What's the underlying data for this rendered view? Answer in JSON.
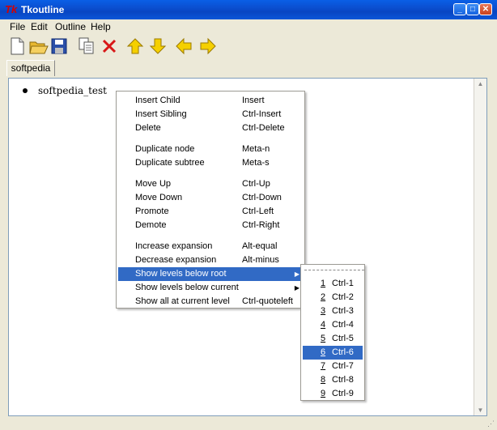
{
  "window": {
    "title": "Tkoutline",
    "app_icon": "Tk"
  },
  "menubar": [
    "File",
    "Edit",
    "Outline",
    "Help"
  ],
  "toolbar": [
    "new-file-icon",
    "open-folder-icon",
    "save-icon",
    "copy-icon",
    "delete-x-icon",
    "arrow-up-icon",
    "arrow-down-icon",
    "arrow-left-icon",
    "arrow-right-icon"
  ],
  "tabs": [
    {
      "label": "softpedia"
    }
  ],
  "outline": {
    "nodes": [
      {
        "text": "softpedia_test"
      }
    ]
  },
  "context_menu": {
    "groups": [
      [
        {
          "label": "Insert Child",
          "accel": "Insert"
        },
        {
          "label": "Insert Sibling",
          "accel": "Ctrl-Insert"
        },
        {
          "label": "Delete",
          "accel": "Ctrl-Delete"
        }
      ],
      [
        {
          "label": "Duplicate node",
          "accel": "Meta-n"
        },
        {
          "label": "Duplicate subtree",
          "accel": "Meta-s"
        }
      ],
      [
        {
          "label": "Move Up",
          "accel": "Ctrl-Up"
        },
        {
          "label": "Move Down",
          "accel": "Ctrl-Down"
        },
        {
          "label": "Promote",
          "accel": "Ctrl-Left"
        },
        {
          "label": "Demote",
          "accel": "Ctrl-Right"
        }
      ],
      [
        {
          "label": "Increase expansion",
          "accel": "Alt-equal"
        },
        {
          "label": "Decrease expansion",
          "accel": "Alt-minus"
        },
        {
          "label": "Show levels below root",
          "accel": "",
          "submenu": true,
          "highlighted": true
        },
        {
          "label": "Show levels below current",
          "accel": "",
          "submenu": true
        },
        {
          "label": "Show all at current level",
          "accel": "Ctrl-quoteleft"
        }
      ]
    ]
  },
  "submenu": {
    "items": [
      {
        "num": "1",
        "accel": "Ctrl-1"
      },
      {
        "num": "2",
        "accel": "Ctrl-2"
      },
      {
        "num": "3",
        "accel": "Ctrl-3"
      },
      {
        "num": "4",
        "accel": "Ctrl-4"
      },
      {
        "num": "5",
        "accel": "Ctrl-5"
      },
      {
        "num": "6",
        "accel": "Ctrl-6",
        "highlighted": true
      },
      {
        "num": "7",
        "accel": "Ctrl-7"
      },
      {
        "num": "8",
        "accel": "Ctrl-8"
      },
      {
        "num": "9",
        "accel": "Ctrl-9"
      }
    ]
  },
  "colors": {
    "highlight": "#316ac5",
    "titlebar": "#0a5fe6"
  }
}
